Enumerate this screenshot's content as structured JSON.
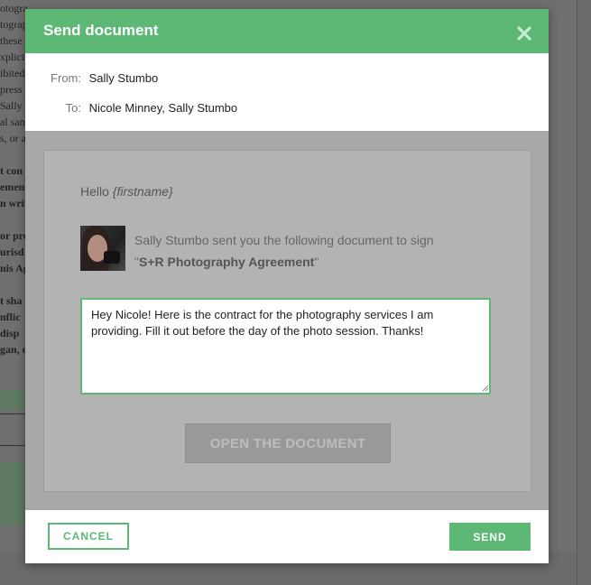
{
  "background_document": {
    "lines": [
      "otogra",
      "tograp",
      "these",
      "xplicit",
      "ibited",
      "press",
      "Sally",
      "al sam",
      "s, or a",
      "",
      "t con",
      "emen",
      "n writ",
      "",
      "or pro",
      "urisd",
      "nis Ag",
      "",
      "t sha",
      "nflic",
      "disp",
      "gan, c"
    ]
  },
  "modal": {
    "title": "Send document",
    "close_icon": "close-icon",
    "from_label": "From:",
    "from_value": "Sally Stumbo",
    "to_label": "To:",
    "to_value": "Nicole Minney, Sally Stumbo"
  },
  "preview": {
    "greeting": "Hello",
    "greeting_placeholder": "{firstname}",
    "sent_text": "Sally Stumbo sent you the following document to sign",
    "document_name_quoted_open": "\"",
    "document_name": "S+R Photography Agreement",
    "document_name_quoted_close": "\"",
    "message": "Hey Nicole! Here is the contract for the photography services I am providing. Fill it out before the day of the photo session. Thanks!",
    "open_button": "OPEN THE DOCUMENT"
  },
  "footer": {
    "cancel_label": "CANCEL",
    "send_label": "SEND"
  },
  "colors": {
    "accent": "#5cb874",
    "overlay": "#6b6b6b",
    "preview_bg": "#a8a8a8"
  }
}
